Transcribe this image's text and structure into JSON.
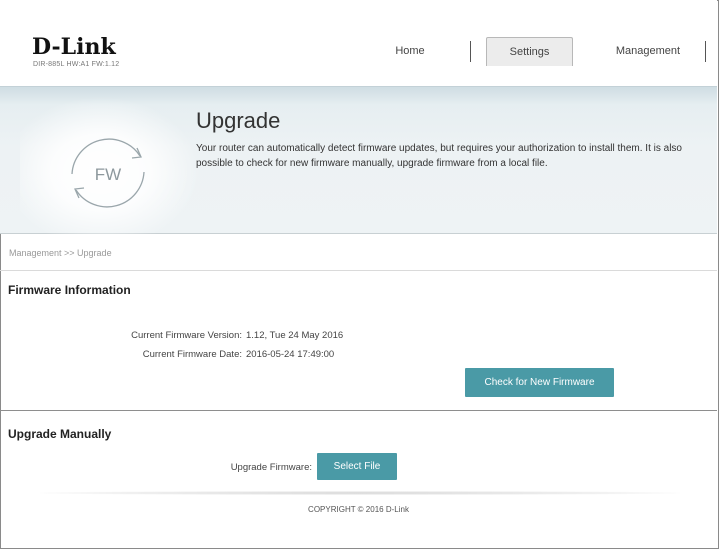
{
  "header": {
    "brand": "D-Link",
    "device_info": "DIR-885L  HW:A1   FW:1.12",
    "nav": {
      "home": "Home",
      "settings": "Settings",
      "management": "Management"
    }
  },
  "banner": {
    "icon_text": "FW",
    "title": "Upgrade",
    "description": "Your router can automatically detect firmware updates, but requires your authorization to install them. It is also possible to check for new firmware manually, upgrade firmware from a local file."
  },
  "breadcrumb": "Management >> Upgrade",
  "firmware_info": {
    "section_title": "Firmware Information",
    "version_label": "Current Firmware Version:",
    "version_value": "1.12, Tue 24 May 2016",
    "date_label": "Current Firmware Date:",
    "date_value": "2016-05-24 17:49:00",
    "check_button": "Check for New Firmware"
  },
  "upgrade_manually": {
    "section_title": "Upgrade Manually",
    "firmware_label": "Upgrade Firmware:",
    "select_button": "Select File"
  },
  "footer": {
    "copyright": "COPYRIGHT © 2016 D-Link"
  },
  "colors": {
    "accent": "#4a9aa6",
    "banner": "#eef3f5"
  }
}
